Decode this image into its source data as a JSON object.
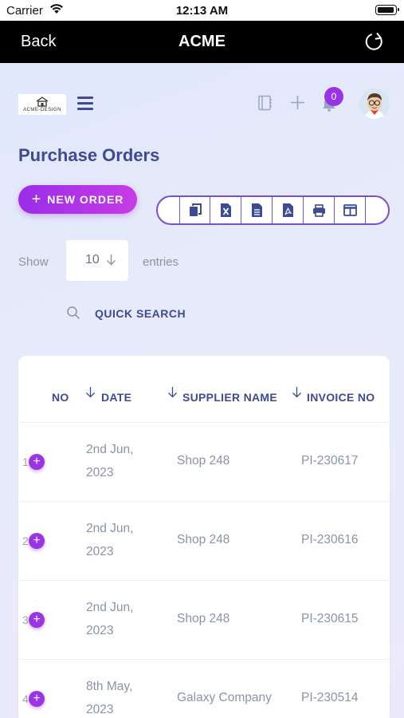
{
  "status_bar": {
    "carrier": "Carrier",
    "time": "12:13 AM"
  },
  "nav": {
    "back_label": "Back",
    "title": "ACME",
    "refresh_icon": "refresh-icon"
  },
  "header": {
    "logo_text": "ACME-DESIGN",
    "menu_icon": "hamburger-menu-icon",
    "notification_count": "0"
  },
  "page": {
    "title": "Purchase Orders",
    "new_order_label": "NEW ORDER",
    "export_buttons": [
      "copy",
      "excel",
      "csv",
      "pdf",
      "print",
      "column-visibility"
    ]
  },
  "entries": {
    "show_label": "Show",
    "value": "10",
    "entries_label": "entries"
  },
  "search": {
    "label": "QUICK SEARCH"
  },
  "table": {
    "columns": [
      "NO",
      "DATE",
      "SUPPLIER NAME",
      "INVOICE NO"
    ],
    "rows": [
      {
        "no": "1",
        "date_line1": "2nd Jun,",
        "date_line2": "2023",
        "supplier": "Shop 248",
        "invoice": "PI-230617"
      },
      {
        "no": "2",
        "date_line1": "2nd Jun,",
        "date_line2": "2023",
        "supplier": "Shop 248",
        "invoice": "PI-230616"
      },
      {
        "no": "3",
        "date_line1": "2nd Jun,",
        "date_line2": "2023",
        "supplier": "Shop 248",
        "invoice": "PI-230615"
      },
      {
        "no": "4",
        "date_line1": "8th May,",
        "date_line2": "2023",
        "supplier": "Galaxy Company",
        "invoice": "PI-230514"
      }
    ]
  },
  "colors": {
    "accent_purple": "#9b2de8",
    "heading_navy": "#3d4a94",
    "muted_text": "#8a93a8"
  }
}
